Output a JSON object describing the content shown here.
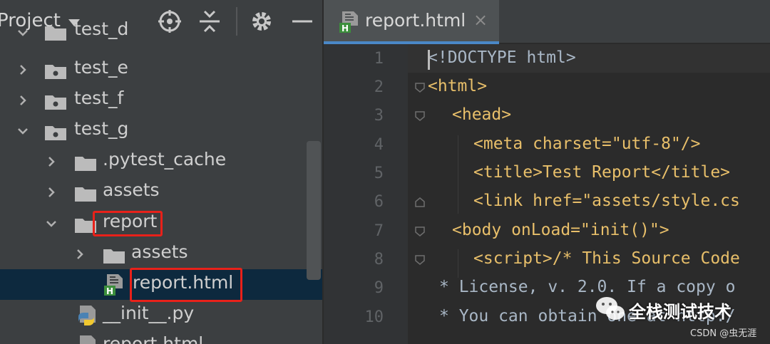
{
  "project_panel": {
    "title": "Project",
    "toolbar_icons": [
      "locate-target-icon",
      "collapse-all-icon",
      "gear-icon",
      "minimize-icon"
    ]
  },
  "tree": [
    {
      "label": "test_d",
      "kind": "folder",
      "state": "expanded"
    },
    {
      "label": "test_e",
      "kind": "folder",
      "state": "collapsed"
    },
    {
      "label": "test_f",
      "kind": "folder",
      "state": "collapsed"
    },
    {
      "label": "test_g",
      "kind": "folder",
      "state": "expanded"
    },
    {
      "label": ".pytest_cache",
      "kind": "folder",
      "state": "collapsed"
    },
    {
      "label": "assets",
      "kind": "folder",
      "state": "collapsed"
    },
    {
      "label": "report",
      "kind": "folder",
      "state": "expanded",
      "highlighted": true
    },
    {
      "label": "assets",
      "kind": "folder",
      "state": "collapsed"
    },
    {
      "label": "report.html",
      "kind": "html-file",
      "selected": true,
      "highlighted": true
    },
    {
      "label": "__init__.py",
      "kind": "python-file"
    },
    {
      "label": "report.html",
      "kind": "html-file"
    }
  ],
  "editor": {
    "tab_label": "report.html",
    "tab_close": "×",
    "lines": [
      {
        "n": "1",
        "text": "<!DOCTYPE html>"
      },
      {
        "n": "2",
        "text": "<html>"
      },
      {
        "n": "3",
        "text": "<head>"
      },
      {
        "n": "4",
        "text": "<meta charset=\"utf-8\"/>"
      },
      {
        "n": "5",
        "text": "<title>Test Report</title>"
      },
      {
        "n": "6",
        "text": "<link href=\"assets/style.cs"
      },
      {
        "n": "7",
        "text": "<body onLoad=\"init()\">"
      },
      {
        "n": "8",
        "text": "<script>/* This Source Code"
      },
      {
        "n": "9",
        "text": "* License, v. 2.0. If a copy o"
      },
      {
        "n": "10",
        "text": "* You can obtain one at http:/"
      }
    ]
  },
  "watermark": {
    "text": "全栈测试技术",
    "credit": "CSDN @虫无涯"
  },
  "colors": {
    "highlight_box": "#e8211a",
    "selection": "#0d293e",
    "tag": "#e8bf6a",
    "string": "#6a8759"
  }
}
